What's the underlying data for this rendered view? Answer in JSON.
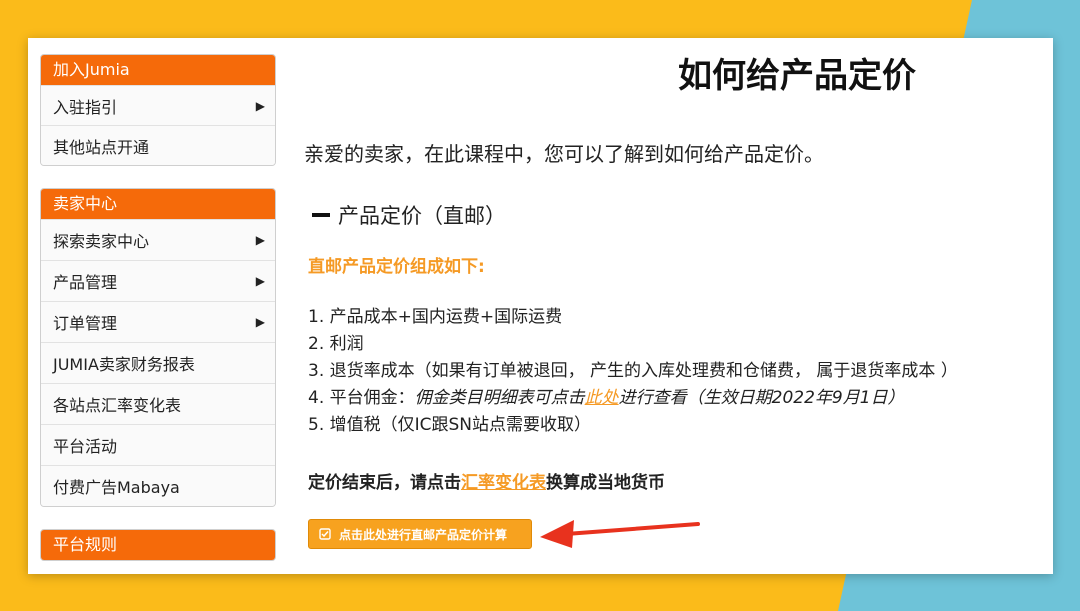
{
  "sidebar": {
    "panels": [
      {
        "title": "加入Jumia",
        "items": [
          {
            "label": "入驻指引",
            "arrow": "▶"
          },
          {
            "label": "其他站点开通"
          }
        ]
      },
      {
        "title": "卖家中心",
        "items": [
          {
            "label": "探索卖家中心",
            "arrow": "▶"
          },
          {
            "label": "产品管理",
            "arrow": "▶"
          },
          {
            "label": "订单管理",
            "arrow": "▶"
          },
          {
            "label": "JUMIA卖家财务报表"
          },
          {
            "label": "各站点汇率变化表"
          },
          {
            "label": "平台活动"
          },
          {
            "label": "付费广告Mabaya"
          }
        ]
      },
      {
        "title": "平台规则",
        "items": []
      }
    ]
  },
  "main": {
    "title": "如何给产品定价",
    "intro": "亲爱的卖家，在此课程中，您可以了解到如何给产品定价。",
    "section_title": "产品定价（直邮）",
    "orange_heading": "直邮产品定价组成如下:",
    "list": [
      "1. 产品成本+国内运费+国际运费",
      "2. 利润",
      "3. 退货率成本（如果有订单被退回， 产生的入库处理费和仓储费， 属于退货率成本 ）"
    ],
    "list4": {
      "prefix": "4. 平台佣金：",
      "italic_a": "佣金类目明细表可点击",
      "link": "此处",
      "italic_b": "进行查看（生效日期2022年9月1日）"
    },
    "list5": "5. 增值税（仅IC跟SN站点需要收取）",
    "after": {
      "prefix": "定价结束后，请点击",
      "link": "汇率变化表",
      "suffix": "换算成当地货币"
    },
    "calc_button": "点击此处进行直邮产品定价计算"
  },
  "colors": {
    "background_yellow": "#fbbb1a",
    "background_blue": "#6ec3d8",
    "accent_orange": "#f56a0a",
    "link_orange": "#f59a25",
    "arrow_red": "#e8321e"
  },
  "icons": {
    "check": "checkbox-icon",
    "dash": "minus-icon",
    "pointer": "red-arrow-icon"
  }
}
